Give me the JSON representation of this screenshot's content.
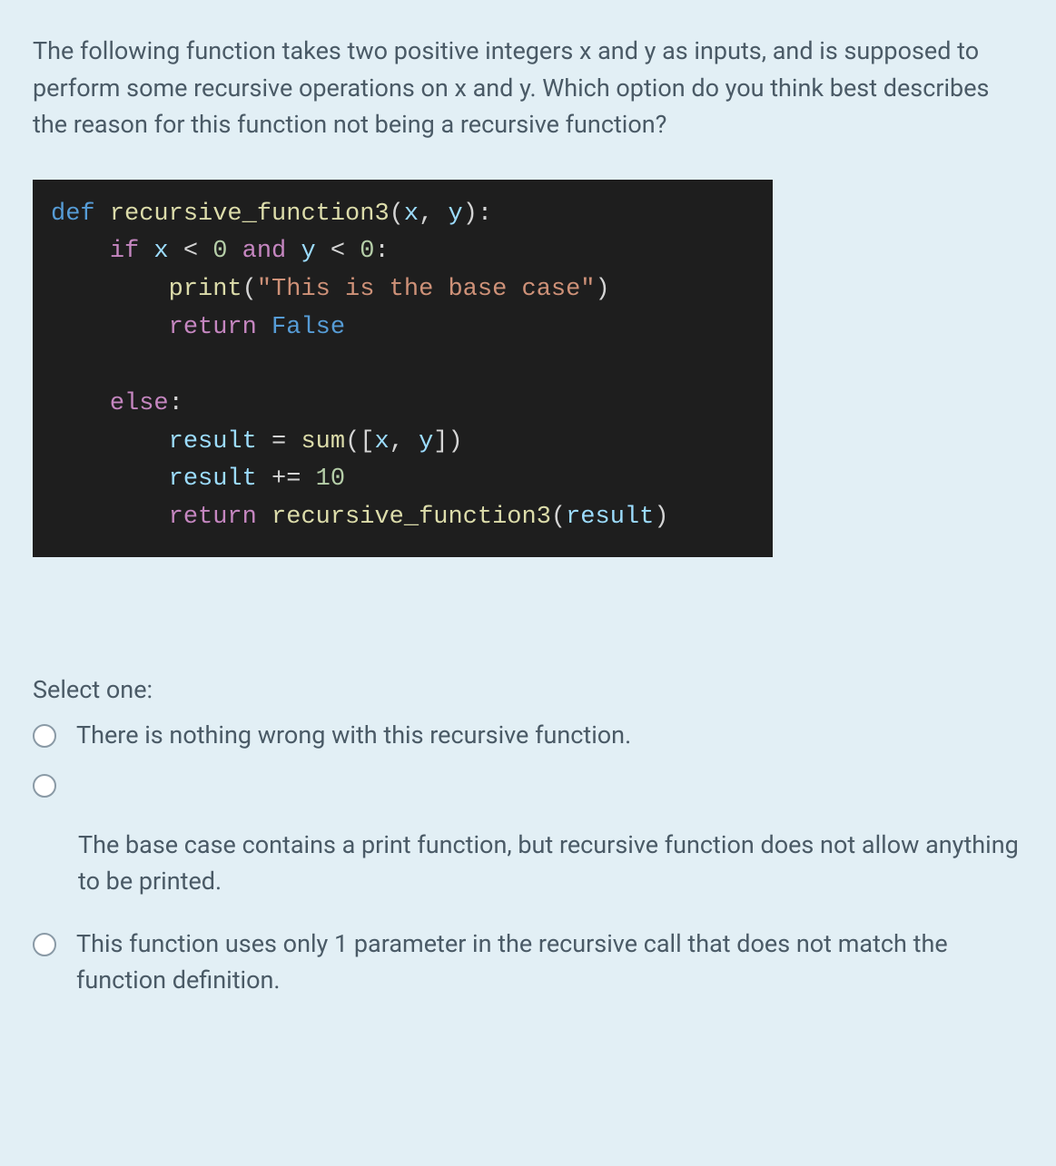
{
  "question": "The following function takes two positive integers x and y as inputs, and is supposed to perform some recursive operations on x and y. Which option do you think best describes the reason for this function not being a recursive function?",
  "code": {
    "line1": {
      "def": "def",
      "fn": "recursive_function3",
      "open": "(",
      "p1": "x",
      "comma": ", ",
      "p2": "y",
      "close": "):"
    },
    "line2": {
      "if": "if",
      "x": "x",
      "lt1": "<",
      "z1": "0",
      "and": "and",
      "y": "y",
      "lt2": "<",
      "z2": "0",
      "colon": ":"
    },
    "line3": {
      "print": "print",
      "open": "(",
      "str": "\"This is the base case\"",
      "close": ")"
    },
    "line4": {
      "return": "return",
      "false": "False"
    },
    "line5": {
      "else": "else",
      "colon": ":"
    },
    "line6": {
      "result": "result",
      "eq": "=",
      "sum": "sum",
      "open": "([",
      "x": "x",
      "comma": ", ",
      "y": "y",
      "close": "])"
    },
    "line7": {
      "result": "result",
      "op": "+=",
      "ten": "10"
    },
    "line8": {
      "return": "return",
      "fn": "recursive_function3",
      "open": "(",
      "arg": "result",
      "close": ")"
    }
  },
  "select_prompt": "Select one:",
  "options": [
    {
      "label": "There is nothing wrong with this recursive function."
    },
    {
      "label": ""
    },
    {
      "label_cont": "The base case contains a print function, but recursive function does not allow anything to be printed."
    },
    {
      "label": "This function uses only 1 parameter in the recursive call that does not match the function definition."
    }
  ]
}
